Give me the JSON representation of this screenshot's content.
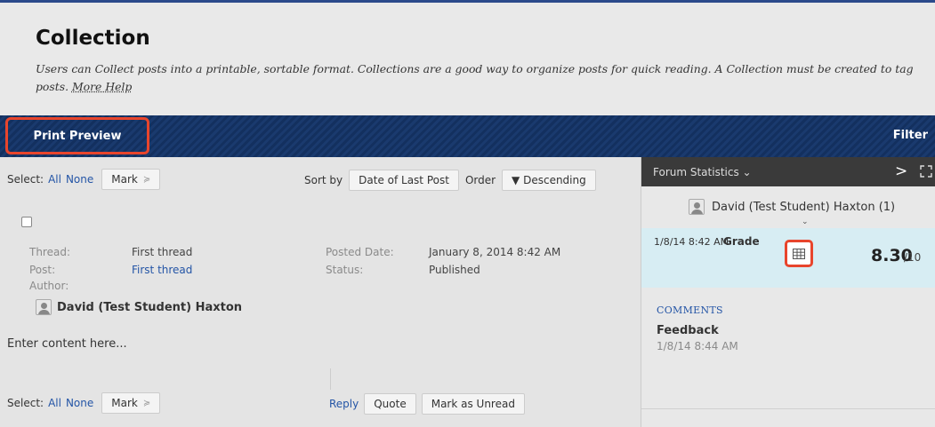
{
  "header": {
    "title": "Collection",
    "description": "Users can Collect posts into a printable, sortable format. Collections are a good way to organize posts for quick reading. A Collection must be created to tag posts.",
    "more_help": "More Help"
  },
  "action_bar": {
    "print_preview": "Print Preview",
    "filter": "Filter"
  },
  "toolbar": {
    "select_label": "Select:",
    "all": "All",
    "none": "None",
    "mark": "Mark",
    "sort_by_label": "Sort by",
    "sort_by_value": "Date of Last Post",
    "order_label": "Order",
    "order_value": "▼ Descending"
  },
  "post": {
    "thread_label": "Thread:",
    "thread_value": "First thread",
    "post_label": "Post:",
    "post_value": "First thread",
    "author_label": "Author:",
    "author_name": "David (Test Student) Haxton",
    "posted_date_label": "Posted Date:",
    "posted_date_value": "January 8, 2014 8:42 AM",
    "status_label": "Status:",
    "status_value": "Published",
    "body": "Enter content here..."
  },
  "bottom_actions": {
    "reply": "Reply",
    "quote": "Quote",
    "mark_unread": "Mark as Unread"
  },
  "sidebar": {
    "title": "Forum Statistics ⌄",
    "next": ">",
    "user": "David (Test Student) Haxton (1)",
    "grade_date": "1/8/14 8:42 AM",
    "grade_label": "Grade",
    "grade_score": "8.30",
    "grade_max": "/10",
    "comments_label": "COMMENTS",
    "feedback_label": "Feedback",
    "feedback_date": "1/8/14 8:44 AM"
  },
  "colors": {
    "action_bar": "#13305f",
    "highlight": "#e8452c",
    "link": "#2455a6",
    "grade_bg": "#d7edf3",
    "sidebar_header": "#3a3a3a"
  }
}
